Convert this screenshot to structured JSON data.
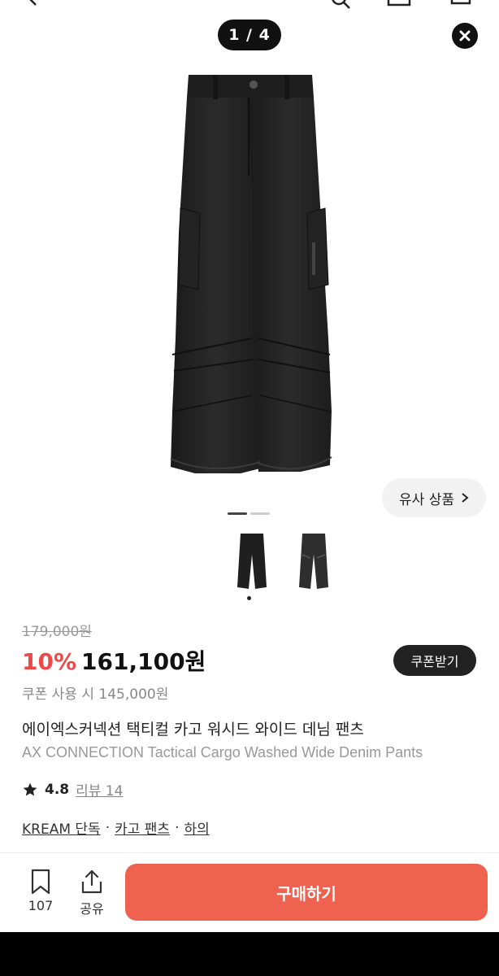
{
  "gallery": {
    "counter": "1 / 4",
    "similar_label": "유사 상품"
  },
  "product": {
    "original_price": "179,000원",
    "discount": "10%",
    "price": "161,100원",
    "coupon_button": "쿠폰받기",
    "coupon_price": "쿠폰 사용 시 145,000원",
    "title_ko": "에이엑스커넥션 택티컬 카고 워시드 와이드  데님 팬츠",
    "title_en": "AX CONNECTION Tactical Cargo Washed Wide Denim Pants",
    "rating": "4.8",
    "review_link": "리뷰 14",
    "breadcrumb": [
      "KREAM 단독",
      "카고 팬츠",
      "하의"
    ],
    "breadcrumb_sep": "·"
  },
  "bottom_bar": {
    "bookmark_count": "107",
    "share_label": "공유",
    "buy_label": "구매하기"
  },
  "colors": {
    "accent": "#ef6250",
    "discount": "#ef4848",
    "dark": "#111111"
  },
  "icons": [
    "back-icon",
    "search-icon",
    "close-icon",
    "chevron-right-icon",
    "star-icon",
    "bookmark-icon",
    "share-icon"
  ]
}
